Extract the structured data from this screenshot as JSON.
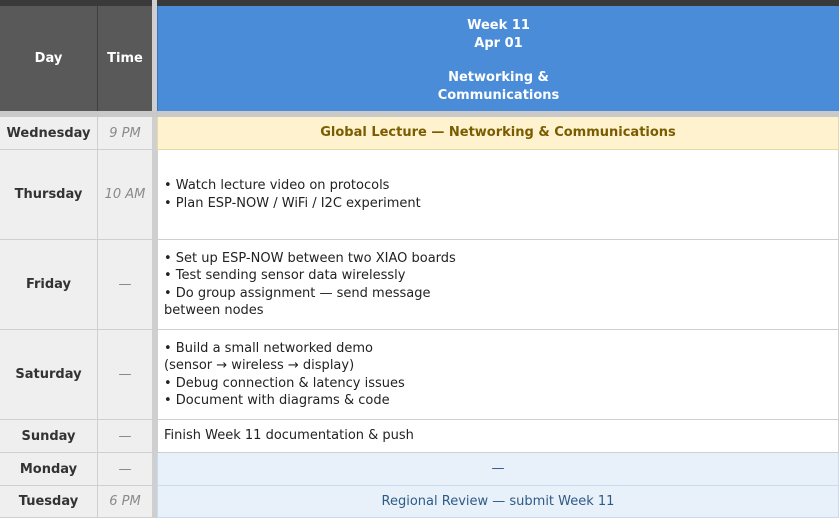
{
  "header": {
    "day_label": "Day",
    "time_label": "Time",
    "week_label": "Week 11",
    "date_label": "Apr 01",
    "topic_line1": "Networking &",
    "topic_line2": "Communications"
  },
  "rows": [
    {
      "day": "Wednesday",
      "time": "9 PM",
      "activity": [
        "Global Lecture — Networking & Communications"
      ]
    },
    {
      "day": "Thursday",
      "time": "10 AM",
      "activity": [
        "• Watch lecture video on protocols",
        "• Plan ESP-NOW / WiFi / I2C experiment"
      ]
    },
    {
      "day": "Friday",
      "time": "—",
      "activity": [
        "• Set up ESP-NOW between two XIAO boards",
        "• Test sending sensor data wirelessly",
        "• Do group assignment — send message",
        "between nodes"
      ]
    },
    {
      "day": "Saturday",
      "time": "—",
      "activity": [
        "• Build a small networked demo",
        "(sensor → wireless → display)",
        "• Debug connection & latency issues",
        "• Document with diagrams & code"
      ]
    },
    {
      "day": "Sunday",
      "time": "—",
      "activity": [
        "Finish Week 11 documentation & push"
      ]
    },
    {
      "day": "Monday",
      "time": "—",
      "activity": [
        "—"
      ]
    },
    {
      "day": "Tuesday",
      "time": "6 PM",
      "activity": [
        "Regional Review — submit Week 11"
      ]
    }
  ],
  "colors": {
    "header_week_bg": "#4a8cd8",
    "header_side_bg": "#595959",
    "lecture_banner_bg": "#fff3cf",
    "review_banner_bg": "#e8f1fa"
  }
}
